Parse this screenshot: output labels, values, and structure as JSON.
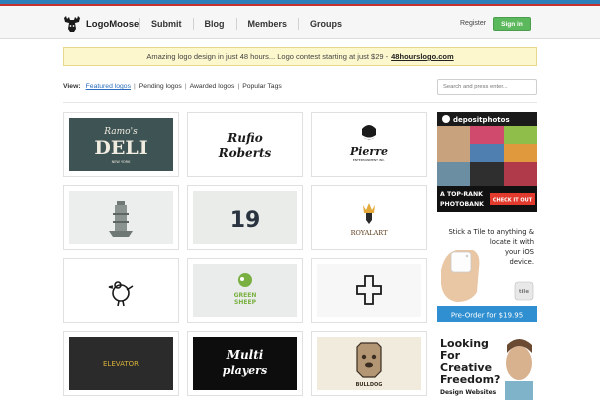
{
  "brand": {
    "name": "LogoMoose"
  },
  "nav": [
    {
      "label": "Submit"
    },
    {
      "label": "Blog"
    },
    {
      "label": "Members"
    },
    {
      "label": "Groups"
    }
  ],
  "auth": {
    "register_label": "Register",
    "signin_label": "Sign in"
  },
  "promo": {
    "text": "Amazing logo design in just 48 hours... Logo contest starting at just $29 - ",
    "link": "48hourslogo.com"
  },
  "filters": {
    "label": "View:",
    "items": [
      "Featured logos",
      "Pending logos",
      "Awarded logos",
      "Popular Tags"
    ],
    "active": "Featured logos"
  },
  "search": {
    "placeholder": "Search and press enter..."
  },
  "logos": [
    {
      "line1": "Ramo's",
      "line2": "DELI",
      "line3": "NEW YORK"
    },
    {
      "line1": "Rufio",
      "line2": "Roberts"
    },
    {
      "line1": "Pierre",
      "line2": "ENTERTAINMENT INC."
    },
    {
      "line1": ""
    },
    {
      "line1": "19"
    },
    {
      "line1": "ROYALART"
    },
    {
      "line1": ""
    },
    {
      "line1": "GREEN",
      "line2": "SHEEP"
    },
    {
      "line1": ""
    },
    {
      "line1": "ELEVATOR"
    },
    {
      "line1": "Multi",
      "line2": "players"
    },
    {
      "line1": "BULLDOG"
    }
  ],
  "ads": {
    "depositphotos": {
      "brand": "depositphotos",
      "line1": "A TOP-RANK",
      "line2": "PHOTOBANK",
      "cta": "CHECK IT OUT"
    },
    "tile": {
      "line1": "Stick a Tile to anything &",
      "line2": "locate it with",
      "line3": "your iOS",
      "line4": "device.",
      "brand": "tile",
      "cta": "Pre-Order for $19.95"
    },
    "creative": {
      "line1": "Looking",
      "line2": "For",
      "line3": "Creative",
      "line4": "Freedom?",
      "line5": "Design Websites"
    }
  },
  "colors": {
    "accent_blue": "#2e7fb8",
    "accent_red": "#c9302c",
    "signin_green": "#5cb85c",
    "promo_bg": "#fcf7cd",
    "link": "#2a6ebb"
  }
}
